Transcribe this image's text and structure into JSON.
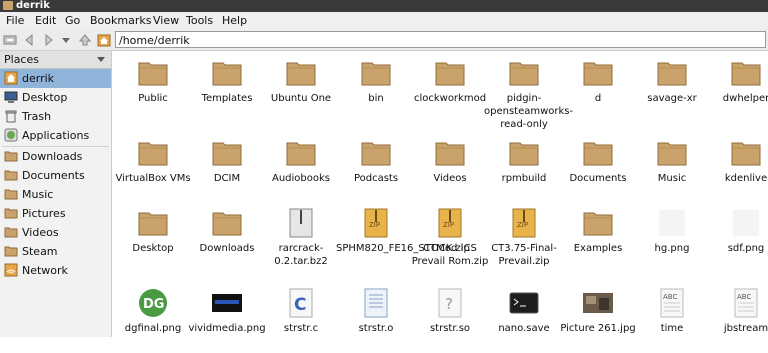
{
  "window": {
    "title": "derrik"
  },
  "menu": [
    "File",
    "Edit",
    "Go",
    "Bookmarks",
    "View",
    "Tools",
    "Help"
  ],
  "toolbar": {
    "path": "/home/derrik"
  },
  "sidebar": {
    "header": "Places",
    "items": [
      {
        "label": "derrik",
        "icon": "home-icon",
        "selected": true
      },
      {
        "label": "Desktop",
        "icon": "desktop-icon"
      },
      {
        "label": "Trash",
        "icon": "trash-icon"
      },
      {
        "label": "Applications",
        "icon": "applications-icon"
      },
      {
        "label": "Downloads",
        "icon": "folder-icon"
      },
      {
        "label": "Documents",
        "icon": "folder-icon"
      },
      {
        "label": "Music",
        "icon": "folder-icon"
      },
      {
        "label": "Pictures",
        "icon": "folder-icon"
      },
      {
        "label": "Videos",
        "icon": "folder-icon"
      },
      {
        "label": "Steam",
        "icon": "folder-icon"
      },
      {
        "label": "Network",
        "icon": "network-icon"
      }
    ]
  },
  "files": [
    {
      "label": "Public",
      "type": "folder"
    },
    {
      "label": "Templates",
      "type": "folder"
    },
    {
      "label": "Ubuntu One",
      "type": "folder"
    },
    {
      "label": "bin",
      "type": "folder"
    },
    {
      "label": "clockworkmod",
      "type": "folder"
    },
    {
      "label": "pidgin-opensteamworks-read-only",
      "type": "folder"
    },
    {
      "label": "d",
      "type": "folder"
    },
    {
      "label": "savage-xr",
      "type": "folder"
    },
    {
      "label": "dwhelper",
      "type": "folder"
    },
    {
      "label": "VirtualBox VMs",
      "type": "folder"
    },
    {
      "label": "DCIM",
      "type": "folder"
    },
    {
      "label": "Audiobooks",
      "type": "folder"
    },
    {
      "label": "Podcasts",
      "type": "folder"
    },
    {
      "label": "Videos",
      "type": "folder"
    },
    {
      "label": "rpmbuild",
      "type": "folder"
    },
    {
      "label": "Documents",
      "type": "folder"
    },
    {
      "label": "Music",
      "type": "folder"
    },
    {
      "label": "kdenlive",
      "type": "folder"
    },
    {
      "label": "Desktop",
      "type": "folder"
    },
    {
      "label": "Downloads",
      "type": "folder"
    },
    {
      "label": "rarcrack-0.2.tar.bz2",
      "type": "archive"
    },
    {
      "label": "SPHM820_FE16_STOCK.zip",
      "type": "zip"
    },
    {
      "label": "CTMod ICS Prevail Rom.zip",
      "type": "zip"
    },
    {
      "label": "CT3.75-Final-Prevail.zip",
      "type": "zip"
    },
    {
      "label": "Examples",
      "type": "folder"
    },
    {
      "label": "hg.png",
      "type": "blank-image"
    },
    {
      "label": "sdf.png",
      "type": "blank-image"
    },
    {
      "label": "dgfinal.png",
      "type": "dg-image",
      "icon_text": "DG"
    },
    {
      "label": "vividmedia.png",
      "type": "vivid-image"
    },
    {
      "label": "strstr.c",
      "type": "c-source",
      "icon_text": "C"
    },
    {
      "label": "strstr.o",
      "type": "object"
    },
    {
      "label": "strstr.so",
      "type": "unknown",
      "icon_text": "?"
    },
    {
      "label": "nano.save",
      "type": "terminal"
    },
    {
      "label": "Picture 261.jpg",
      "type": "photo"
    },
    {
      "label": "time",
      "type": "text",
      "icon_text": "ABC"
    },
    {
      "label": "jbstream",
      "type": "text",
      "icon_text": "ABC"
    }
  ],
  "colors": {
    "folder": "#c9a36b",
    "selection": "#8fb3d9",
    "titlebar": "#3a3a3a"
  }
}
